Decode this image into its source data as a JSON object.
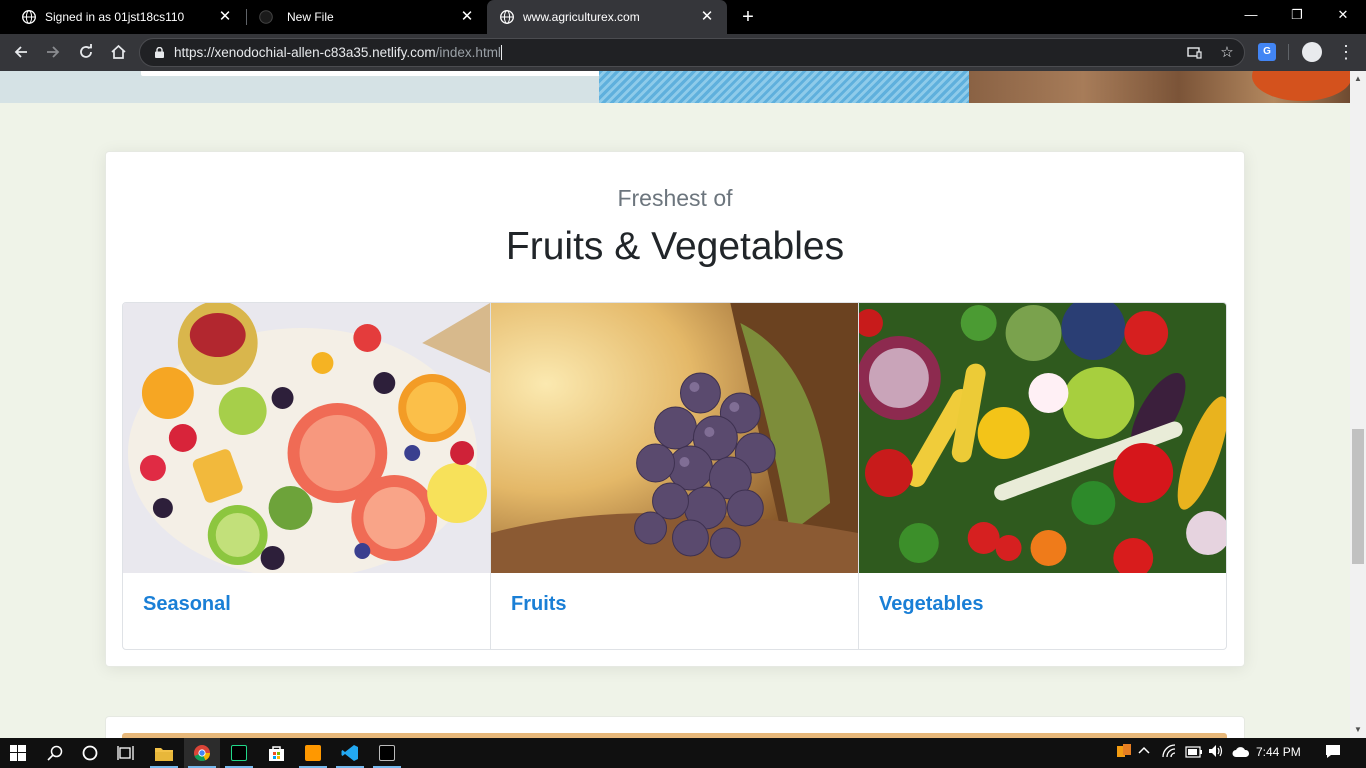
{
  "browser": {
    "tabs": [
      {
        "title": "Signed in as 01jst18cs110",
        "icon": "globe-icon",
        "active": false
      },
      {
        "title": "New File",
        "icon": "github-icon",
        "active": false
      },
      {
        "title": "www.agriculturex.com",
        "icon": "globe-icon",
        "active": true
      }
    ],
    "close_glyph": "✕",
    "new_tab_glyph": "+",
    "url": {
      "host": "https://xenodochial-allen-c83a35.netlify.com",
      "path": "/index.html"
    },
    "window_controls": {
      "minimize": "—",
      "maximize": "❐",
      "close": "✕"
    },
    "extension_label": "G"
  },
  "page": {
    "section": {
      "subtitle": "Freshest of",
      "title": "Fruits & Vegetables",
      "categories": [
        {
          "label": "Seasonal",
          "image": "fruit-platter-image"
        },
        {
          "label": "Fruits",
          "image": "grapes-image"
        },
        {
          "label": "Vegetables",
          "image": "vegetables-image"
        }
      ]
    }
  },
  "taskbar": {
    "apps": [
      "start-icon",
      "search-icon",
      "cortana-icon",
      "task-view-icon",
      "file-explorer-icon",
      "chrome-icon",
      "pycharm-icon",
      "store-icon",
      "sublime-icon",
      "vscode-icon",
      "terminal-icon"
    ],
    "time": "7:44 PM"
  },
  "colors": {
    "link": "#1a7fd6",
    "page_background": "#eff3e8",
    "toolbar": "#35363a"
  }
}
